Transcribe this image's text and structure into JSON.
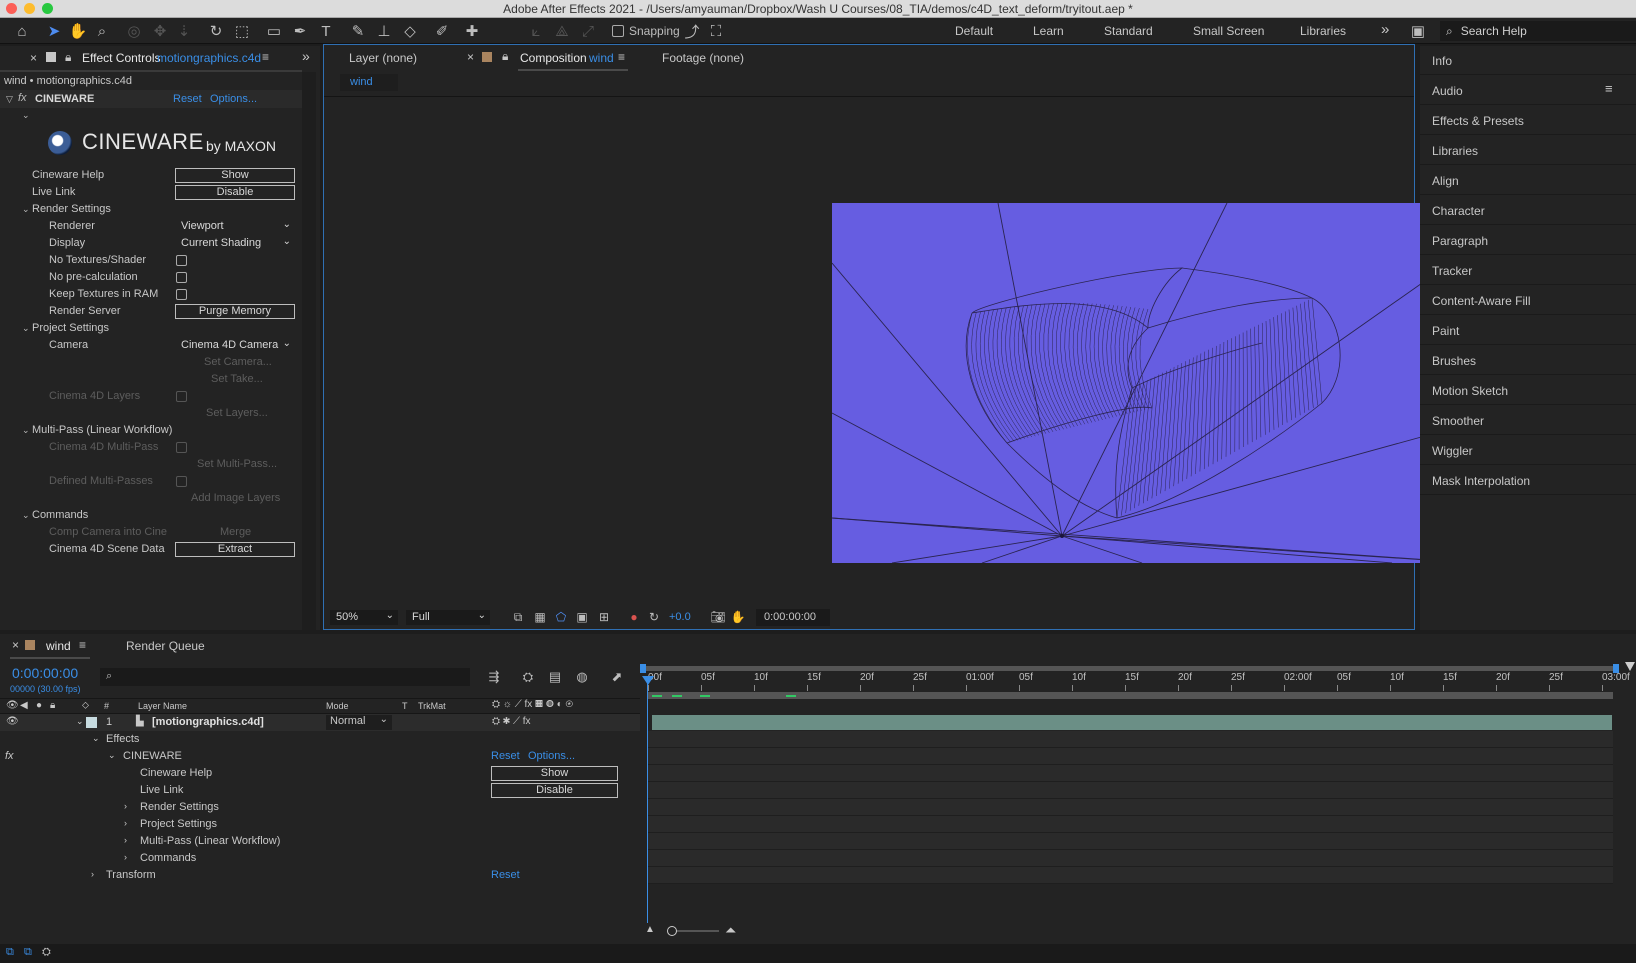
{
  "window": {
    "title": "Adobe After Effects 2021 - /Users/amyauman/Dropbox/Wash U Courses/08_TIA/demos/c4D_text_deform/tryitout.aep *"
  },
  "toolbar": {
    "snapping_label": "Snapping",
    "workspaces": [
      "Default",
      "Learn",
      "Standard",
      "Small Screen",
      "Libraries"
    ],
    "search_placeholder": "Search Help"
  },
  "effect_controls": {
    "tab_label": "Effect Controls",
    "tab_file": "motiongraphics.c4d",
    "layer_path": "wind • motiongraphics.c4d",
    "effect_name": "CINEWARE",
    "reset": "Reset",
    "options": "Options...",
    "logo_text": "CINEWARE",
    "logo_by": "by MAXON",
    "rows": {
      "cineware_help": "Cineware Help",
      "show_btn": "Show",
      "live_link": "Live Link",
      "disable_btn": "Disable",
      "render_settings": "Render Settings",
      "renderer": "Renderer",
      "renderer_value": "Viewport",
      "display": "Display",
      "display_value": "Current Shading",
      "no_textures": "No Textures/Shader",
      "no_precalc": "No pre-calculation",
      "keep_textures": "Keep Textures in RAM",
      "render_server": "Render Server",
      "purge_btn": "Purge Memory",
      "project_settings": "Project Settings",
      "camera": "Camera",
      "camera_value": "Cinema 4D Camera",
      "set_camera": "Set Camera...",
      "set_take": "Set Take...",
      "c4d_layers": "Cinema 4D Layers",
      "set_layers": "Set Layers...",
      "multipass": "Multi-Pass (Linear Workflow)",
      "c4d_multipass": "Cinema 4D Multi-Pass",
      "set_multipass": "Set Multi-Pass...",
      "defined_multipasses": "Defined Multi-Passes",
      "add_image_layers": "Add Image Layers",
      "commands": "Commands",
      "comp_camera": "Comp Camera into Cine",
      "merge_btn": "Merge",
      "scene_data": "Cinema 4D Scene Data",
      "extract_btn": "Extract"
    }
  },
  "composition": {
    "layer_tab": "Layer (none)",
    "comp_tab_label": "Composition",
    "comp_tab_name": "wind",
    "footage_tab": "Footage (none)",
    "breadcrumb": "wind",
    "zoom": "50%",
    "resolution": "Full",
    "exposure": "+0.0",
    "timecode": "0:00:00:00"
  },
  "right_panel": {
    "items": [
      "Info",
      "Audio",
      "Effects & Presets",
      "Libraries",
      "Align",
      "Character",
      "Paragraph",
      "Tracker",
      "Content-Aware Fill",
      "Paint",
      "Brushes",
      "Motion Sketch",
      "Smoother",
      "Wiggler",
      "Mask Interpolation"
    ]
  },
  "timeline": {
    "comp_tab": "wind",
    "render_queue": "Render Queue",
    "timecode": "0:00:00:00",
    "frame_info": "00000 (30.00 fps)",
    "col_num": "#",
    "col_layer_name": "Layer Name",
    "col_mode": "Mode",
    "col_t": "T",
    "col_trkmat": "TrkMat",
    "layer_index": "1",
    "layer_name": "[motiongraphics.c4d]",
    "layer_mode": "Normal",
    "effects": "Effects",
    "cineware": "CINEWARE",
    "reset": "Reset",
    "options": "Options...",
    "cineware_help": "Cineware Help",
    "show_btn": "Show",
    "live_link": "Live Link",
    "disable_btn": "Disable",
    "render_settings": "Render Settings",
    "project_settings": "Project Settings",
    "multipass": "Multi-Pass (Linear Workflow)",
    "commands": "Commands",
    "transform": "Transform",
    "transform_reset": "Reset",
    "ruler_ticks": [
      "00f",
      "05f",
      "10f",
      "15f",
      "20f",
      "25f",
      "01:00f",
      "05f",
      "10f",
      "15f",
      "20f",
      "25f",
      "02:00f",
      "05f",
      "10f",
      "15f",
      "20f",
      "25f",
      "03:00f"
    ]
  },
  "colors": {
    "viewer_bg": "#665de1",
    "accent_blue": "#3a8ee6",
    "panel_bg": "#232323"
  }
}
